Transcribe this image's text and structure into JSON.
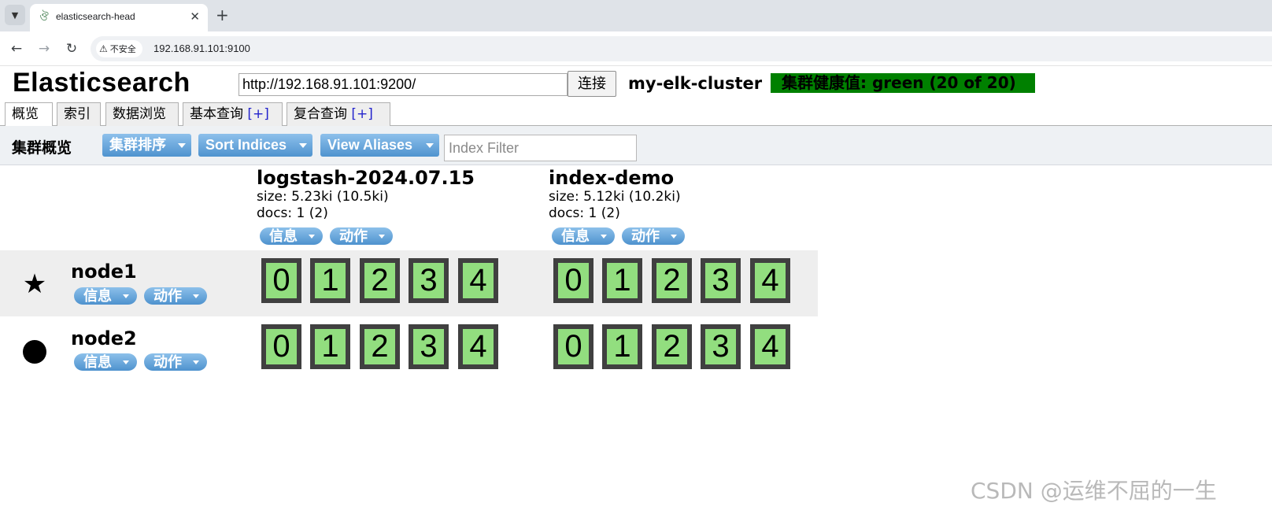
{
  "browser": {
    "tab_title": "elasticsearch-head",
    "tab_close": "✕",
    "new_tab": "+",
    "security_label": "不安全",
    "url": "192.168.91.101:9100"
  },
  "header": {
    "title": "Elasticsearch",
    "connect_url": "http://192.168.91.101:9200/",
    "connect_label": "连接",
    "cluster_name": "my-elk-cluster",
    "health": "集群健康值: green (20 of 20)"
  },
  "tabs": [
    {
      "label": "概览",
      "plus": ""
    },
    {
      "label": "索引",
      "plus": ""
    },
    {
      "label": "数据浏览",
      "plus": ""
    },
    {
      "label": "基本查询",
      "plus": "[+]"
    },
    {
      "label": "复合查询",
      "plus": "[+]"
    }
  ],
  "overview": {
    "title": "集群概览",
    "sort_cluster": "集群排序",
    "sort_indices": "Sort Indices",
    "view_aliases": "View Aliases",
    "filter_placeholder": "Index Filter"
  },
  "menus": {
    "info": "信息",
    "action": "动作"
  },
  "indices": [
    {
      "name": "logstash-2024.07.15",
      "size": "size: 5.23ki (10.5ki)",
      "docs": "docs: 1 (2)"
    },
    {
      "name": "index-demo",
      "size": "size: 5.12ki (10.2ki)",
      "docs": "docs: 1 (2)"
    }
  ],
  "nodes": [
    {
      "name": "node1",
      "marker": "star-icon",
      "shards": [
        [
          "0",
          "1",
          "2",
          "3",
          "4"
        ],
        [
          "0",
          "1",
          "2",
          "3",
          "4"
        ]
      ]
    },
    {
      "name": "node2",
      "marker": "dot-icon",
      "shards": [
        [
          "0",
          "1",
          "2",
          "3",
          "4"
        ],
        [
          "0",
          "1",
          "2",
          "3",
          "4"
        ]
      ]
    }
  ],
  "colors": {
    "health_green": "#008000",
    "shard_fill": "#92de7f",
    "shard_border": "#404040",
    "button_blue": "#4f93cf"
  },
  "watermark": "CSDN @运维不屈的一生"
}
